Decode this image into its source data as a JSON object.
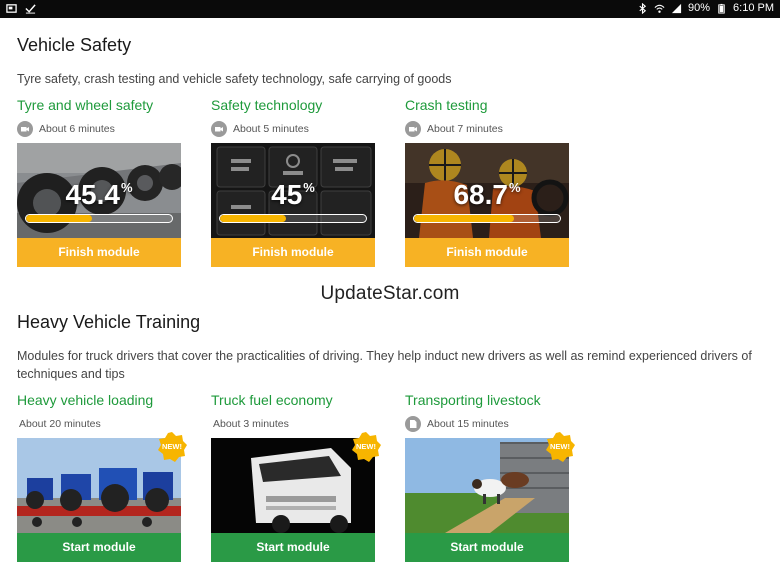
{
  "status_bar": {
    "battery": "90%",
    "time": "6:10 PM",
    "icons": [
      "screenshot-icon",
      "checkmark-icon",
      "bluetooth-icon",
      "wifi-icon",
      "signal-icon",
      "battery-icon"
    ]
  },
  "sections": [
    {
      "title": "Vehicle Safety",
      "description": "Tyre safety, crash testing and vehicle safety technology, safe carrying of goods",
      "modules": [
        {
          "title": "Tyre and wheel safety",
          "duration": "About 6 minutes",
          "percent_label": "45.4",
          "percent_symbol": "%",
          "progress": 0.454,
          "button": "Finish module",
          "image": "truck-tyres"
        },
        {
          "title": "Safety technology",
          "duration": "About 5 minutes",
          "percent_label": "45",
          "percent_symbol": "%",
          "progress": 0.45,
          "button": "Finish module",
          "image": "dashboard-buttons"
        },
        {
          "title": "Crash testing",
          "duration": "About 7 minutes",
          "percent_label": "68.7",
          "percent_symbol": "%",
          "progress": 0.687,
          "button": "Finish module",
          "image": "crash-test-dummies"
        }
      ]
    },
    {
      "title": "Heavy Vehicle Training",
      "description": "Modules for truck drivers that cover the practicalities of driving. They help induct new drivers as well as remind experienced drivers of techniques and tips",
      "modules": [
        {
          "title": "Heavy vehicle loading",
          "duration": "About 20 minutes",
          "badge": "NEW!",
          "button": "Start module",
          "image": "tractors-on-trailer"
        },
        {
          "title": "Truck fuel economy",
          "duration": "About 3 minutes",
          "badge": "NEW!",
          "button": "Start module",
          "image": "white-truck"
        },
        {
          "title": "Transporting livestock",
          "duration": "About 15 minutes",
          "badge": "NEW!",
          "button": "Start module",
          "image": "cattle-ramp"
        }
      ]
    }
  ],
  "watermark": "UpdateStar.com",
  "colors": {
    "accent_green": "#1e9a3b",
    "finish_button": "#f7b224",
    "start_button": "#2a9a46",
    "progress_fill": "#f7b500",
    "badge": "#f7b500"
  }
}
